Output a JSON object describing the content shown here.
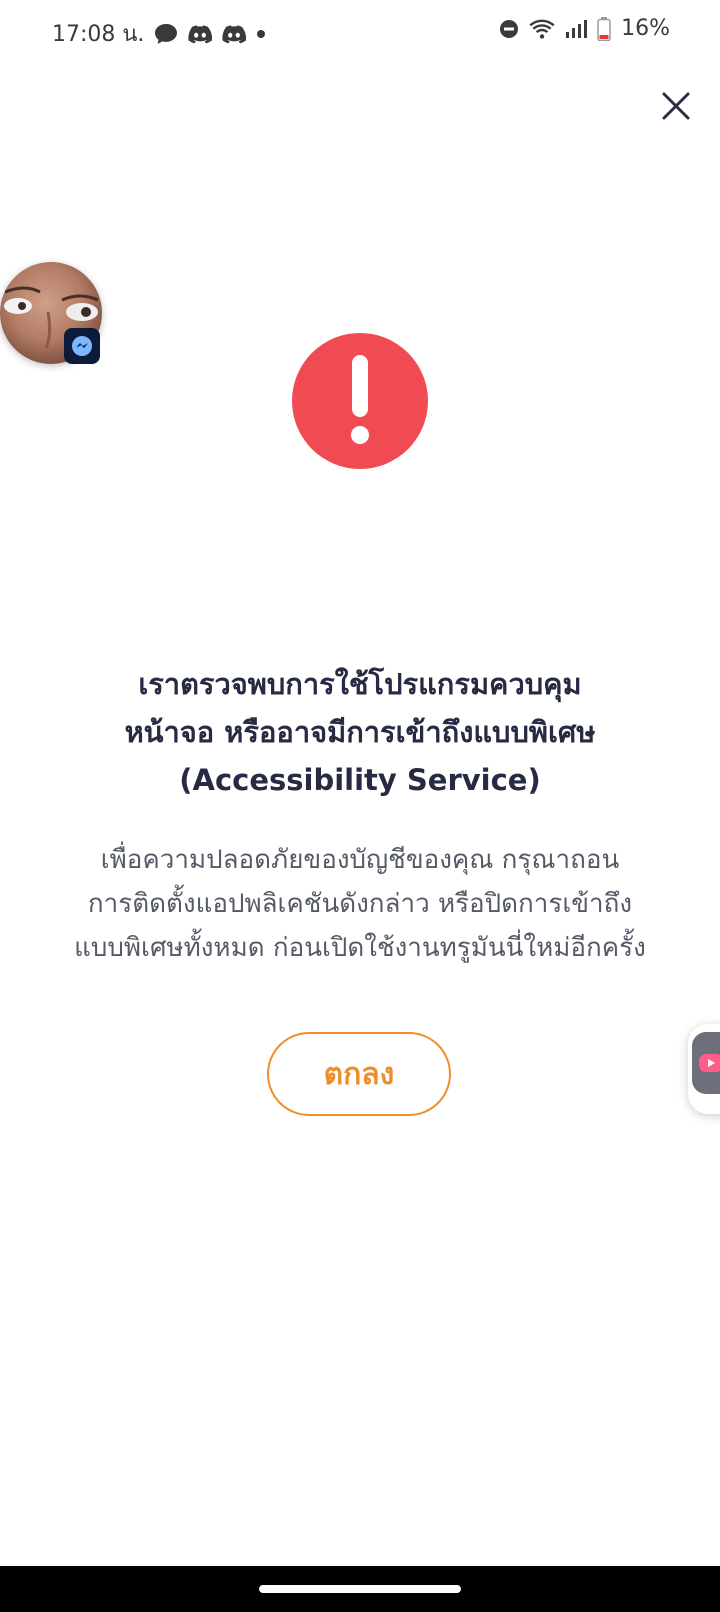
{
  "status_bar": {
    "time": "17:08 น.",
    "battery": "16%",
    "icons_left": [
      "chat-bubble-icon",
      "discord-icon",
      "discord-icon",
      "dot-icon"
    ],
    "icons_right": [
      "do-not-disturb-icon",
      "wifi-icon",
      "signal-icon",
      "battery-low-icon"
    ]
  },
  "dialog": {
    "close_icon": "close-icon",
    "alert_icon": "exclamation-icon",
    "title_lines": [
      "เราตรวจพบการใช้โปรแกรมควบคุม",
      "หน้าจอ หรืออาจมีการเข้าถึงแบบพิเศษ",
      "(Accessibility Service)"
    ],
    "description_lines": [
      "เพื่อความปลอดภัยของบัญชีของคุณ กรุณาถอน",
      "การติดตั้งแอปพลิเคชันดังกล่าว หรือปิดการเข้าถึง",
      "แบบพิเศษทั้งหมด ก่อนเปิดใช้งานทรูมันนี่ใหม่อีกครั้ง"
    ],
    "ok_label": "ตกลง"
  },
  "colors": {
    "alert": "#f04a52",
    "accent": "#ef8d2c",
    "title": "#272a43",
    "body": "#555a66"
  }
}
